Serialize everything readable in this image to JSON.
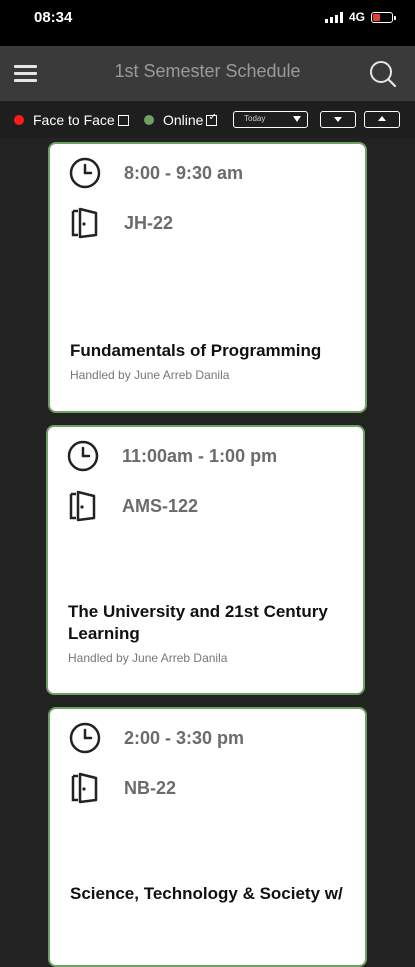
{
  "status_bar": {
    "time": "08:34",
    "network": "4G"
  },
  "header": {
    "title": "1st Semester Schedule"
  },
  "filters": {
    "face_to_face_label": "Face to Face",
    "online_label": "Online",
    "online_checked": true,
    "face_to_face_checked": false,
    "period_select": "Today",
    "colors": {
      "face_to_face": "#ff1a1a",
      "online": "#6ea163"
    }
  },
  "schedule": [
    {
      "time": "8:00 - 9:30 am",
      "room": "JH-22",
      "course": "Fundamentals of Programming",
      "handler": "Handled by June Arreb Danila"
    },
    {
      "time": "11:00am - 1:00 pm",
      "room": "AMS-122",
      "course": "The University and 21st Century Learning",
      "handler": "Handled by June Arreb Danila"
    },
    {
      "time": "2:00 - 3:30 pm",
      "room": "NB-22",
      "course": "Science, Technology & Society w/",
      "handler": ""
    }
  ]
}
